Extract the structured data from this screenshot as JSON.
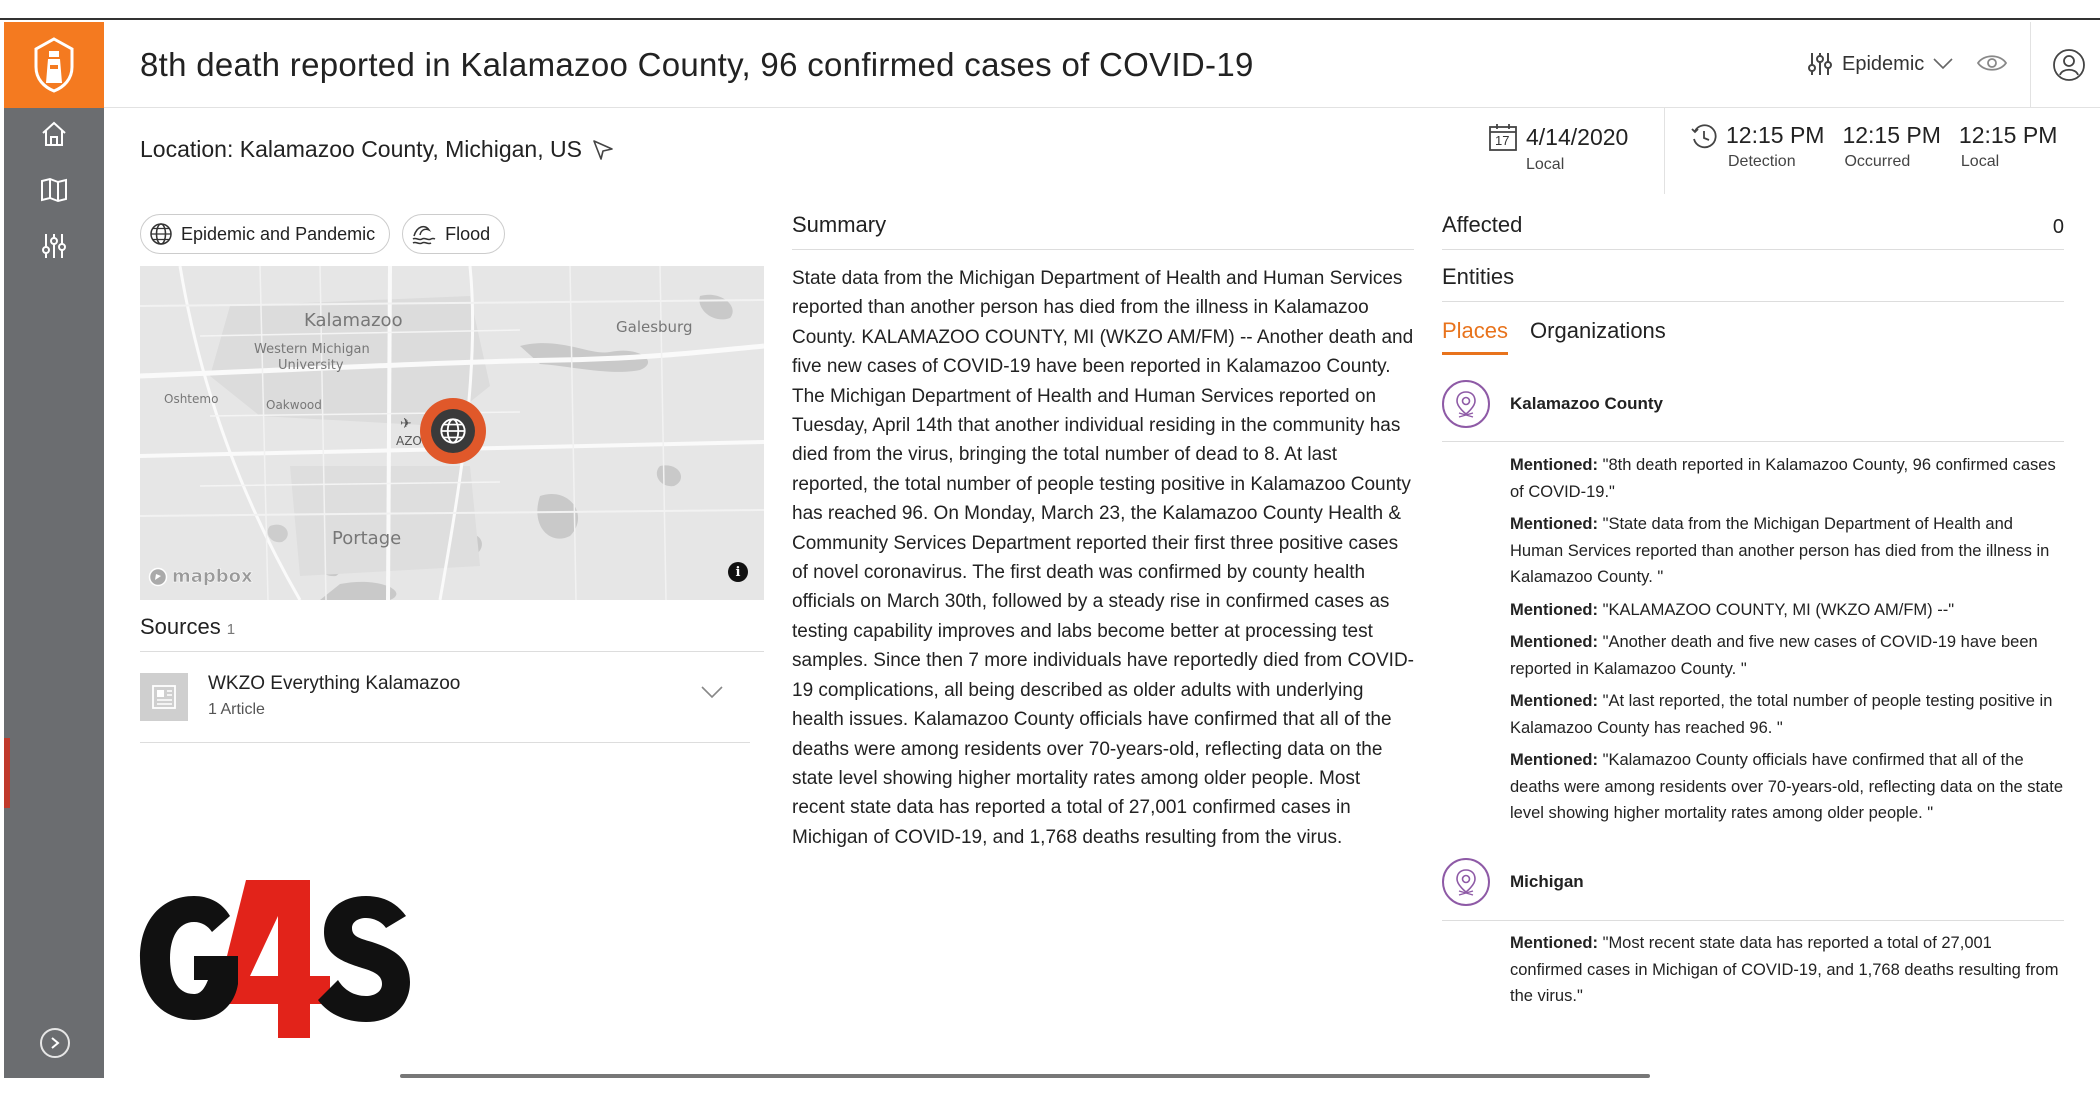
{
  "header": {
    "title": "8th death reported in Kalamazoo County, 96 confirmed cases of COVID-19",
    "filter_label": "Epidemic"
  },
  "location": {
    "text": "Location: Kalamazoo County, Michigan, US"
  },
  "date": {
    "icon_day": "17",
    "value": "4/14/2020",
    "label": "Local"
  },
  "times": [
    {
      "value": "12:15 PM",
      "label": "Detection"
    },
    {
      "value": "12:15 PM",
      "label": "Occurred"
    },
    {
      "value": "12:15 PM",
      "label": "Local"
    }
  ],
  "tags": [
    {
      "label": "Epidemic and Pandemic",
      "icon": "globe-icon"
    },
    {
      "label": "Flood",
      "icon": "flood-icon"
    }
  ],
  "map": {
    "labels": {
      "kalamazoo": "Kalamazoo",
      "galesburg": "Galesburg",
      "wmu": "Western Michigan",
      "wmu2": "University",
      "oshtemo": "Oshtemo",
      "oakwood": "Oakwood",
      "azo": "AZO",
      "portage": "Portage"
    },
    "brand": "mapbox"
  },
  "sources": {
    "title": "Sources",
    "count": "1",
    "items": [
      {
        "name": "WKZO Everything Kalamazoo",
        "sub": "1 Article"
      }
    ]
  },
  "summary": {
    "title": "Summary",
    "text": "State data from the Michigan Department of Health and Human Services reported than another person has died from the illness in Kalamazoo County. KALAMAZOO COUNTY, MI (WKZO AM/FM) -- Another death and five new cases of COVID-19 have been reported in Kalamazoo County. The Michigan Department of Health and Human Services reported on Tuesday, April 14th that another individual residing in the community has died from the virus, bringing the total number of dead to 8. At last reported, the total number of people testing positive in Kalamazoo County has reached 96. On Monday, March 23, the Kalamazoo County Health & Community Services Department reported their first three positive cases of novel coronavirus. The first death was confirmed by county health officials on March 30th, followed by a steady rise in confirmed cases as testing capability improves and labs become better at processing test samples. Since then 7 more individuals have reportedly died from COVID-19 complications, all being described as older adults with underlying health issues. Kalamazoo County officials have confirmed that all of the deaths were among residents over 70-years-old, reflecting data on the state level showing higher mortality rates among older people. Most recent state data has reported a total of 27,001 confirmed cases in Michigan of COVID-19, and 1,768 deaths resulting from the virus."
  },
  "affected": {
    "label": "Affected",
    "value": "0"
  },
  "entities": {
    "title": "Entities",
    "tabs": [
      "Places",
      "Organizations"
    ],
    "places": [
      {
        "name": "Kalamazoo County",
        "mentions": [
          {
            "label": "Mentioned:",
            "text": " \"8th death reported in Kalamazoo County, 96 confirmed cases of COVID-19.\""
          },
          {
            "label": "Mentioned:",
            "text": " \"State data from the Michigan Department of Health and Human Services reported than another person has died from the illness in Kalamazoo County. \""
          },
          {
            "label": "Mentioned:",
            "text": " \"KALAMAZOO COUNTY, MI (WKZO AM/FM) --\""
          },
          {
            "label": "Mentioned:",
            "text": " \"Another death and five new cases of COVID-19 have been reported in Kalamazoo County. \""
          },
          {
            "label": "Mentioned:",
            "text": " \"At last reported, the total number of people testing positive in Kalamazoo County has reached 96. \""
          },
          {
            "label": "Mentioned:",
            "text": " \"Kalamazoo County officials have confirmed that all of the deaths were among residents over 70-years-old, reflecting data on the state level showing higher mortality rates among older people. \""
          }
        ]
      },
      {
        "name": "Michigan",
        "mentions": [
          {
            "label": "Mentioned:",
            "text": " \"Most recent state data has reported a total of 27,001 confirmed cases in Michigan of COVID-19, and 1,768 deaths resulting from the virus.\""
          }
        ]
      }
    ]
  },
  "logo": {
    "text": "G4S"
  },
  "colors": {
    "accent": "#f47a20",
    "sidebar": "#6b6d70",
    "pin": "#8e5aa6",
    "map_marker": "#e0582a"
  }
}
